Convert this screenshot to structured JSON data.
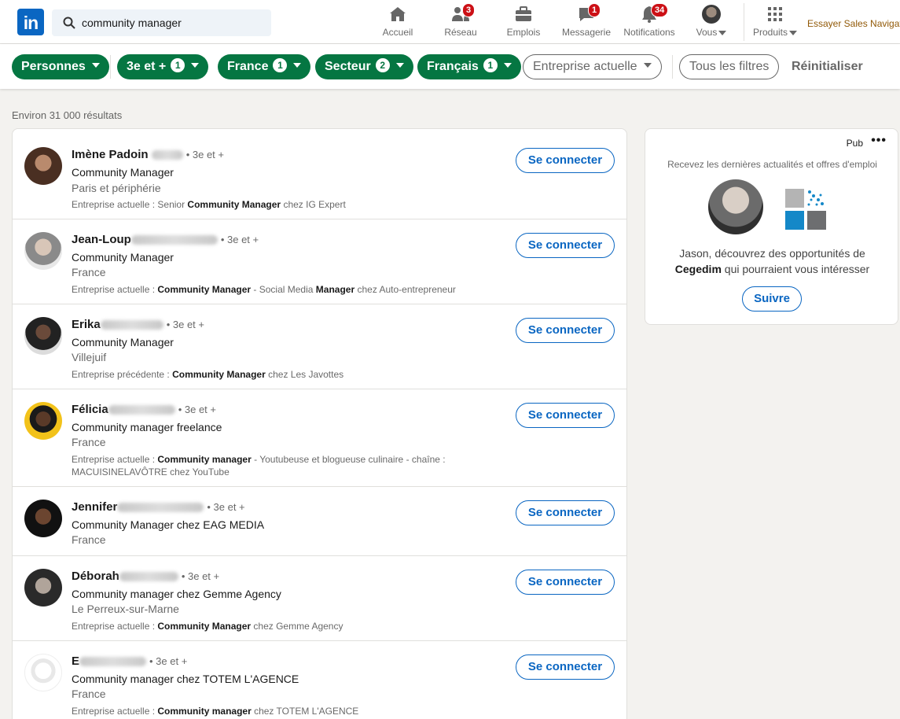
{
  "nav": {
    "search_value": "community manager",
    "items": [
      {
        "label": "Accueil",
        "badge": ""
      },
      {
        "label": "Réseau",
        "badge": "3"
      },
      {
        "label": "Emplois",
        "badge": ""
      },
      {
        "label": "Messagerie",
        "badge": "1"
      },
      {
        "label": "Notifications",
        "badge": "34"
      },
      {
        "label": "Vous",
        "badge": ""
      },
      {
        "label": "Produits",
        "badge": ""
      }
    ],
    "sales_navigator": "Essayer Sales Navigator"
  },
  "filters": {
    "people": "Personnes",
    "degree": {
      "label": "3e et +",
      "count": "1"
    },
    "location": {
      "label": "France",
      "count": "1"
    },
    "sector": {
      "label": "Secteur",
      "count": "2"
    },
    "language": {
      "label": "Français",
      "count": "1"
    },
    "current_company": "Entreprise actuelle",
    "all_filters": "Tous les filtres",
    "reset": "Réinitialiser"
  },
  "results_count": "Environ 31 000 résultats",
  "connect_label": "Se connecter",
  "results": [
    {
      "name": "Imène Padoin",
      "degree": "• 3e et +",
      "title": "Community Manager",
      "location": "Paris et périphérie",
      "summary_prefix": "Entreprise actuelle  : Senior ",
      "summary_bold1": "Community Manager",
      "summary_mid": " chez IG Expert",
      "summary_bold2": "",
      "summary_suffix": ""
    },
    {
      "name": "Jean-Loup",
      "degree": "• 3e et +",
      "title": "Community Manager",
      "location": "France",
      "summary_prefix": "Entreprise actuelle  : ",
      "summary_bold1": "Community Manager",
      "summary_mid": " - Social Media ",
      "summary_bold2": "Manager",
      "summary_suffix": " chez Auto-entrepreneur"
    },
    {
      "name": "Erika",
      "degree": "• 3e et +",
      "title": "Community Manager",
      "location": "Villejuif",
      "summary_prefix": "Entreprise précédente  : ",
      "summary_bold1": "Community Manager",
      "summary_mid": " chez Les Javottes",
      "summary_bold2": "",
      "summary_suffix": ""
    },
    {
      "name": "Félicia",
      "degree": "• 3e et +",
      "title": "Community manager freelance",
      "location": "France",
      "summary_prefix": "Entreprise actuelle  : ",
      "summary_bold1": "Community manager",
      "summary_mid": " - Youtubeuse et blogueuse culinaire - chaîne : MACUISINELAVÔTRE chez YouTube",
      "summary_bold2": "",
      "summary_suffix": ""
    },
    {
      "name": "Jennifer",
      "degree": "• 3e et +",
      "title": "Community Manager chez EAG MEDIA",
      "location": "France",
      "summary_prefix": "",
      "summary_bold1": "",
      "summary_mid": "",
      "summary_bold2": "",
      "summary_suffix": ""
    },
    {
      "name": "Déborah",
      "degree": "• 3e et +",
      "title": "Community manager chez Gemme Agency",
      "location": "Le Perreux-sur-Marne",
      "summary_prefix": "Entreprise actuelle  : ",
      "summary_bold1": "Community Manager",
      "summary_mid": " chez Gemme Agency",
      "summary_bold2": "",
      "summary_suffix": ""
    },
    {
      "name": "E",
      "degree": "• 3e et +",
      "title": "Community manager chez TOTEM L'AGENCE",
      "location": "France",
      "summary_prefix": "Entreprise actuelle  : ",
      "summary_bold1": "Community manager",
      "summary_mid": " chez TOTEM L'AGENCE",
      "summary_bold2": "",
      "summary_suffix": ""
    }
  ],
  "ad": {
    "label": "Pub",
    "more": "•••",
    "subtitle": "Recevez les dernières actualités et offres d'emploi",
    "text_prefix": "Jason, découvrez des opportunités de",
    "company": "Cegedim",
    "text_suffix": " qui pourraient vous intéresser",
    "follow": "Suivre"
  },
  "colors": {
    "brand": "#0a66c2",
    "filter_active": "#057642",
    "notification": "#cc1016"
  }
}
